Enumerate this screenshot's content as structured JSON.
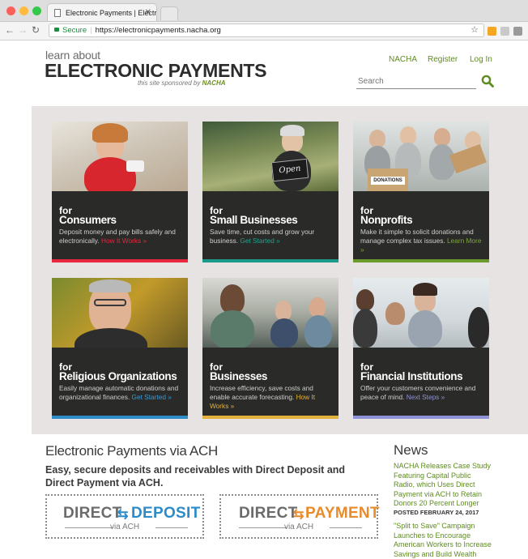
{
  "browser": {
    "tab_title": "Electronic Payments | Electro",
    "secure_label": "Secure",
    "url": "https://electronicpayments.nacha.org"
  },
  "site": {
    "logo_small": "learn about",
    "logo_big": "ELECTRONIC PAYMENTS",
    "sponsor_text": "this site sponsored by",
    "sponsor_name": "NACHA",
    "nav": [
      "NACHA",
      "Register",
      "Log In"
    ],
    "search_placeholder": "Search"
  },
  "cards": [
    {
      "for": "for",
      "title": "Consumers",
      "desc": "Deposit money and pay bills safely and electronically.",
      "link": "How It Works »",
      "link_color": "#e8263d",
      "bar_color": "#e8263d"
    },
    {
      "for": "for",
      "title": "Small Businesses",
      "desc": "Save time, cut costs and grow your business.",
      "link": "Get Started »",
      "link_color": "#21a38d",
      "bar_color": "#1b9a8a"
    },
    {
      "for": "for",
      "title": "Nonprofits",
      "desc": "Make it simple to solicit donations and manage complex tax issues.",
      "link": "Learn More »",
      "link_color": "#7da83a",
      "bar_color": "#6a9a2b"
    },
    {
      "for": "for",
      "title": "Religious Organizations",
      "desc": "Easily manage automatic donations and organizational finances.",
      "link": "Get Started »",
      "link_color": "#3a9bd6",
      "bar_color": "#2d8cc8"
    },
    {
      "for": "for",
      "title": "Businesses",
      "desc": "Increase efficiency, save costs and enable accurate forecasting.",
      "link": "How It Works »",
      "link_color": "#e3b23c",
      "bar_color": "#e3b23c"
    },
    {
      "for": "for",
      "title": "Financial Institutions",
      "desc": "Offer your customers convenience and peace of mind.",
      "link": "Next Steps »",
      "link_color": "#8f93d6",
      "bar_color": "#8f93d6"
    }
  ],
  "ach": {
    "title": "Electronic Payments via ACH",
    "subtitle": "Easy, secure deposits and receivables with Direct Deposit and Direct Payment via ACH.",
    "deposit": {
      "word1": "DIRECT",
      "word2": "DEPOSIT",
      "via": "via ACH",
      "color": "#2d8cc8"
    },
    "payment": {
      "word1": "DIRECT",
      "word2": "PAYMENT",
      "via": "via ACH",
      "color": "#e98b2b"
    }
  },
  "news": {
    "title": "News",
    "items": [
      {
        "headline": "NACHA Releases Case Study Featuring Capital Public Radio, which Uses Direct Payment via ACH to Retain Donors 20 Percent Longer",
        "date": "POSTED FEBRUARY 24, 2017"
      },
      {
        "headline": "\"Split to Save\" Campaign Launches to Encourage American Workers to Increase Savings and Build Wealth",
        "date": ""
      }
    ]
  }
}
